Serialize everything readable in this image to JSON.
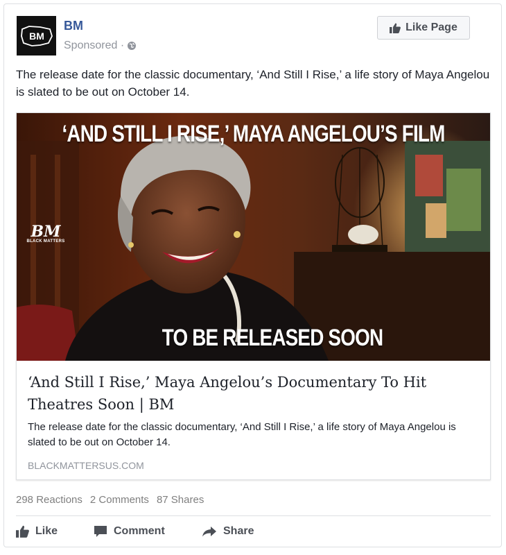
{
  "post": {
    "page_name": "BM",
    "avatar_text": "BM",
    "sponsored_label": "Sponsored ·",
    "like_page_label": "Like Page",
    "text": "The release date for the classic documentary, ‘And Still I Rise,’ a life story of Maya Angelou is slated to be out on October 14."
  },
  "link_card": {
    "image_headline_top": "‘AND STILL I RISE,’ MAYA ANGELOU’S FILM",
    "image_headline_bottom": "TO BE RELEASED SOON",
    "image_logo_large": "BM",
    "image_logo_small": "BLACK MATTERS",
    "title": "‘And Still I Rise,’ Maya Angelou’s Documentary To Hit Theatres Soon | BM",
    "description": "The release date for the classic documentary, ‘And Still I Rise,’ a life story of Maya Angelou is slated to be out on October 14.",
    "domain": "BLACKMATTERSUS.COM"
  },
  "stats": {
    "reactions": "298 Reactions",
    "comments": "2 Comments",
    "shares": "87 Shares"
  },
  "actions": {
    "like": "Like",
    "comment": "Comment",
    "share": "Share"
  },
  "icons": {
    "like": "thumbs-up-icon",
    "comment": "speech-bubble-icon",
    "share": "share-arrow-icon",
    "audience": "globe-icon"
  },
  "colors": {
    "link_blue": "#365899",
    "meta_gray": "#90949c",
    "button_text": "#4b4f56"
  }
}
